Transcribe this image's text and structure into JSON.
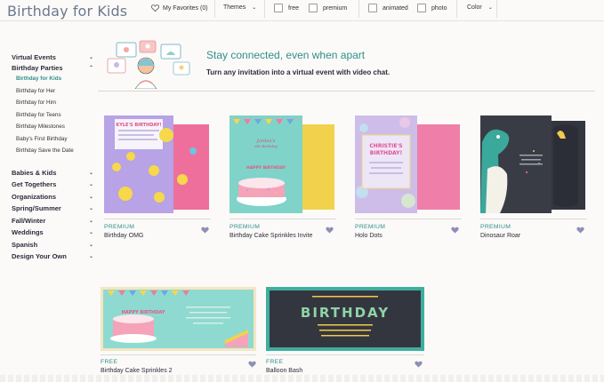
{
  "header": {
    "title": "Birthday for Kids",
    "favorites": "My Favorites (0)",
    "themes": "Themes",
    "filters": [
      {
        "label": "free"
      },
      {
        "label": "premium"
      },
      {
        "label": "animated"
      },
      {
        "label": "photo"
      }
    ],
    "color": "Color"
  },
  "sidebar": {
    "groups1": [
      {
        "label": "Virtual Events",
        "chevron": "down"
      },
      {
        "label": "Birthday Parties",
        "chevron": "up"
      }
    ],
    "subitems": [
      {
        "label": "Birthday for Kids",
        "active": true
      },
      {
        "label": "Birthday for Her"
      },
      {
        "label": "Birthday for Him"
      },
      {
        "label": "Birthday for Teens"
      },
      {
        "label": "Birthday Milestones"
      },
      {
        "label": "Baby's First Birthday"
      },
      {
        "label": "Birthday Save the Date"
      }
    ],
    "groups2": [
      {
        "label": "Babies & Kids"
      },
      {
        "label": "Get Togethers"
      },
      {
        "label": "Organizations"
      },
      {
        "label": "Spring/Summer"
      },
      {
        "label": "Fall/Winter"
      },
      {
        "label": "Weddings"
      },
      {
        "label": "Spanish"
      },
      {
        "label": "Design Your Own"
      }
    ]
  },
  "banner": {
    "heading": "Stay connected, even when apart",
    "subheading": "Turn any invitation into a virtual event with video chat."
  },
  "cards": [
    {
      "tier": "PREMIUM",
      "name": "Birthday OMG",
      "card_text": [
        "KYLE'S BIRTHDAY!"
      ]
    },
    {
      "tier": "PREMIUM",
      "name": "Birthday Cake Sprinkles Invite",
      "card_text": [
        "Jordan's",
        "6th Birthday",
        "HAPPY BIRTHDAY"
      ]
    },
    {
      "tier": "PREMIUM",
      "name": "Holo Dots",
      "card_text": [
        "CHRISTIE'S",
        "BIRTHDAY!"
      ]
    },
    {
      "tier": "PREMIUM",
      "name": "Dinosaur Roar",
      "card_text": []
    },
    {
      "tier": "FREE",
      "name": "Birthday Cake Sprinkles 2",
      "card_text": [
        "HAPPY BIRTHDAY"
      ]
    },
    {
      "tier": "FREE",
      "name": "Balloon Bash",
      "card_text": [
        "BIRTHDAY"
      ]
    }
  ],
  "colors": {
    "accent": "#2f8f8a",
    "heart": "#8e8fb5",
    "title": "#6b7a8f"
  }
}
